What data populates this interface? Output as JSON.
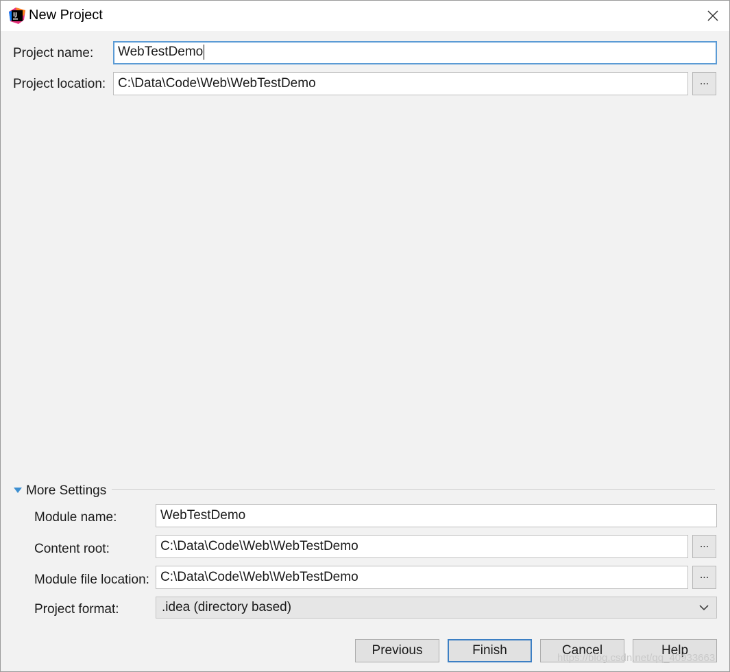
{
  "window": {
    "title": "New Project"
  },
  "project": {
    "name_label": "Project name:",
    "name_value": "WebTestDemo",
    "location_label": "Project location:",
    "location_value": "C:\\Data\\Code\\Web\\WebTestDemo",
    "browse_label": "..."
  },
  "more_settings": {
    "header": "More Settings",
    "expanded": true,
    "module_name_label": "Module name:",
    "module_name_value": "WebTestDemo",
    "content_root_label": "Content root:",
    "content_root_value": "C:\\Data\\Code\\Web\\WebTestDemo",
    "module_file_label": "Module file location:",
    "module_file_value": "C:\\Data\\Code\\Web\\WebTestDemo",
    "format_label": "Project format:",
    "format_value": ".idea (directory based)",
    "browse_label": "..."
  },
  "buttons": {
    "previous": "Previous",
    "finish": "Finish",
    "cancel": "Cancel",
    "help": "Help"
  },
  "watermark": "https://blog.csdn.net/qq_40933663",
  "colors": {
    "focus_border": "#5b9bd5",
    "default_button_border": "#3c7fc4",
    "section_arrow": "#3d8fd1"
  },
  "icons": {
    "app": "intellij-idea-icon",
    "close": "close-icon",
    "section_toggle": "triangle-down-icon",
    "dropdown": "chevron-down-icon"
  }
}
